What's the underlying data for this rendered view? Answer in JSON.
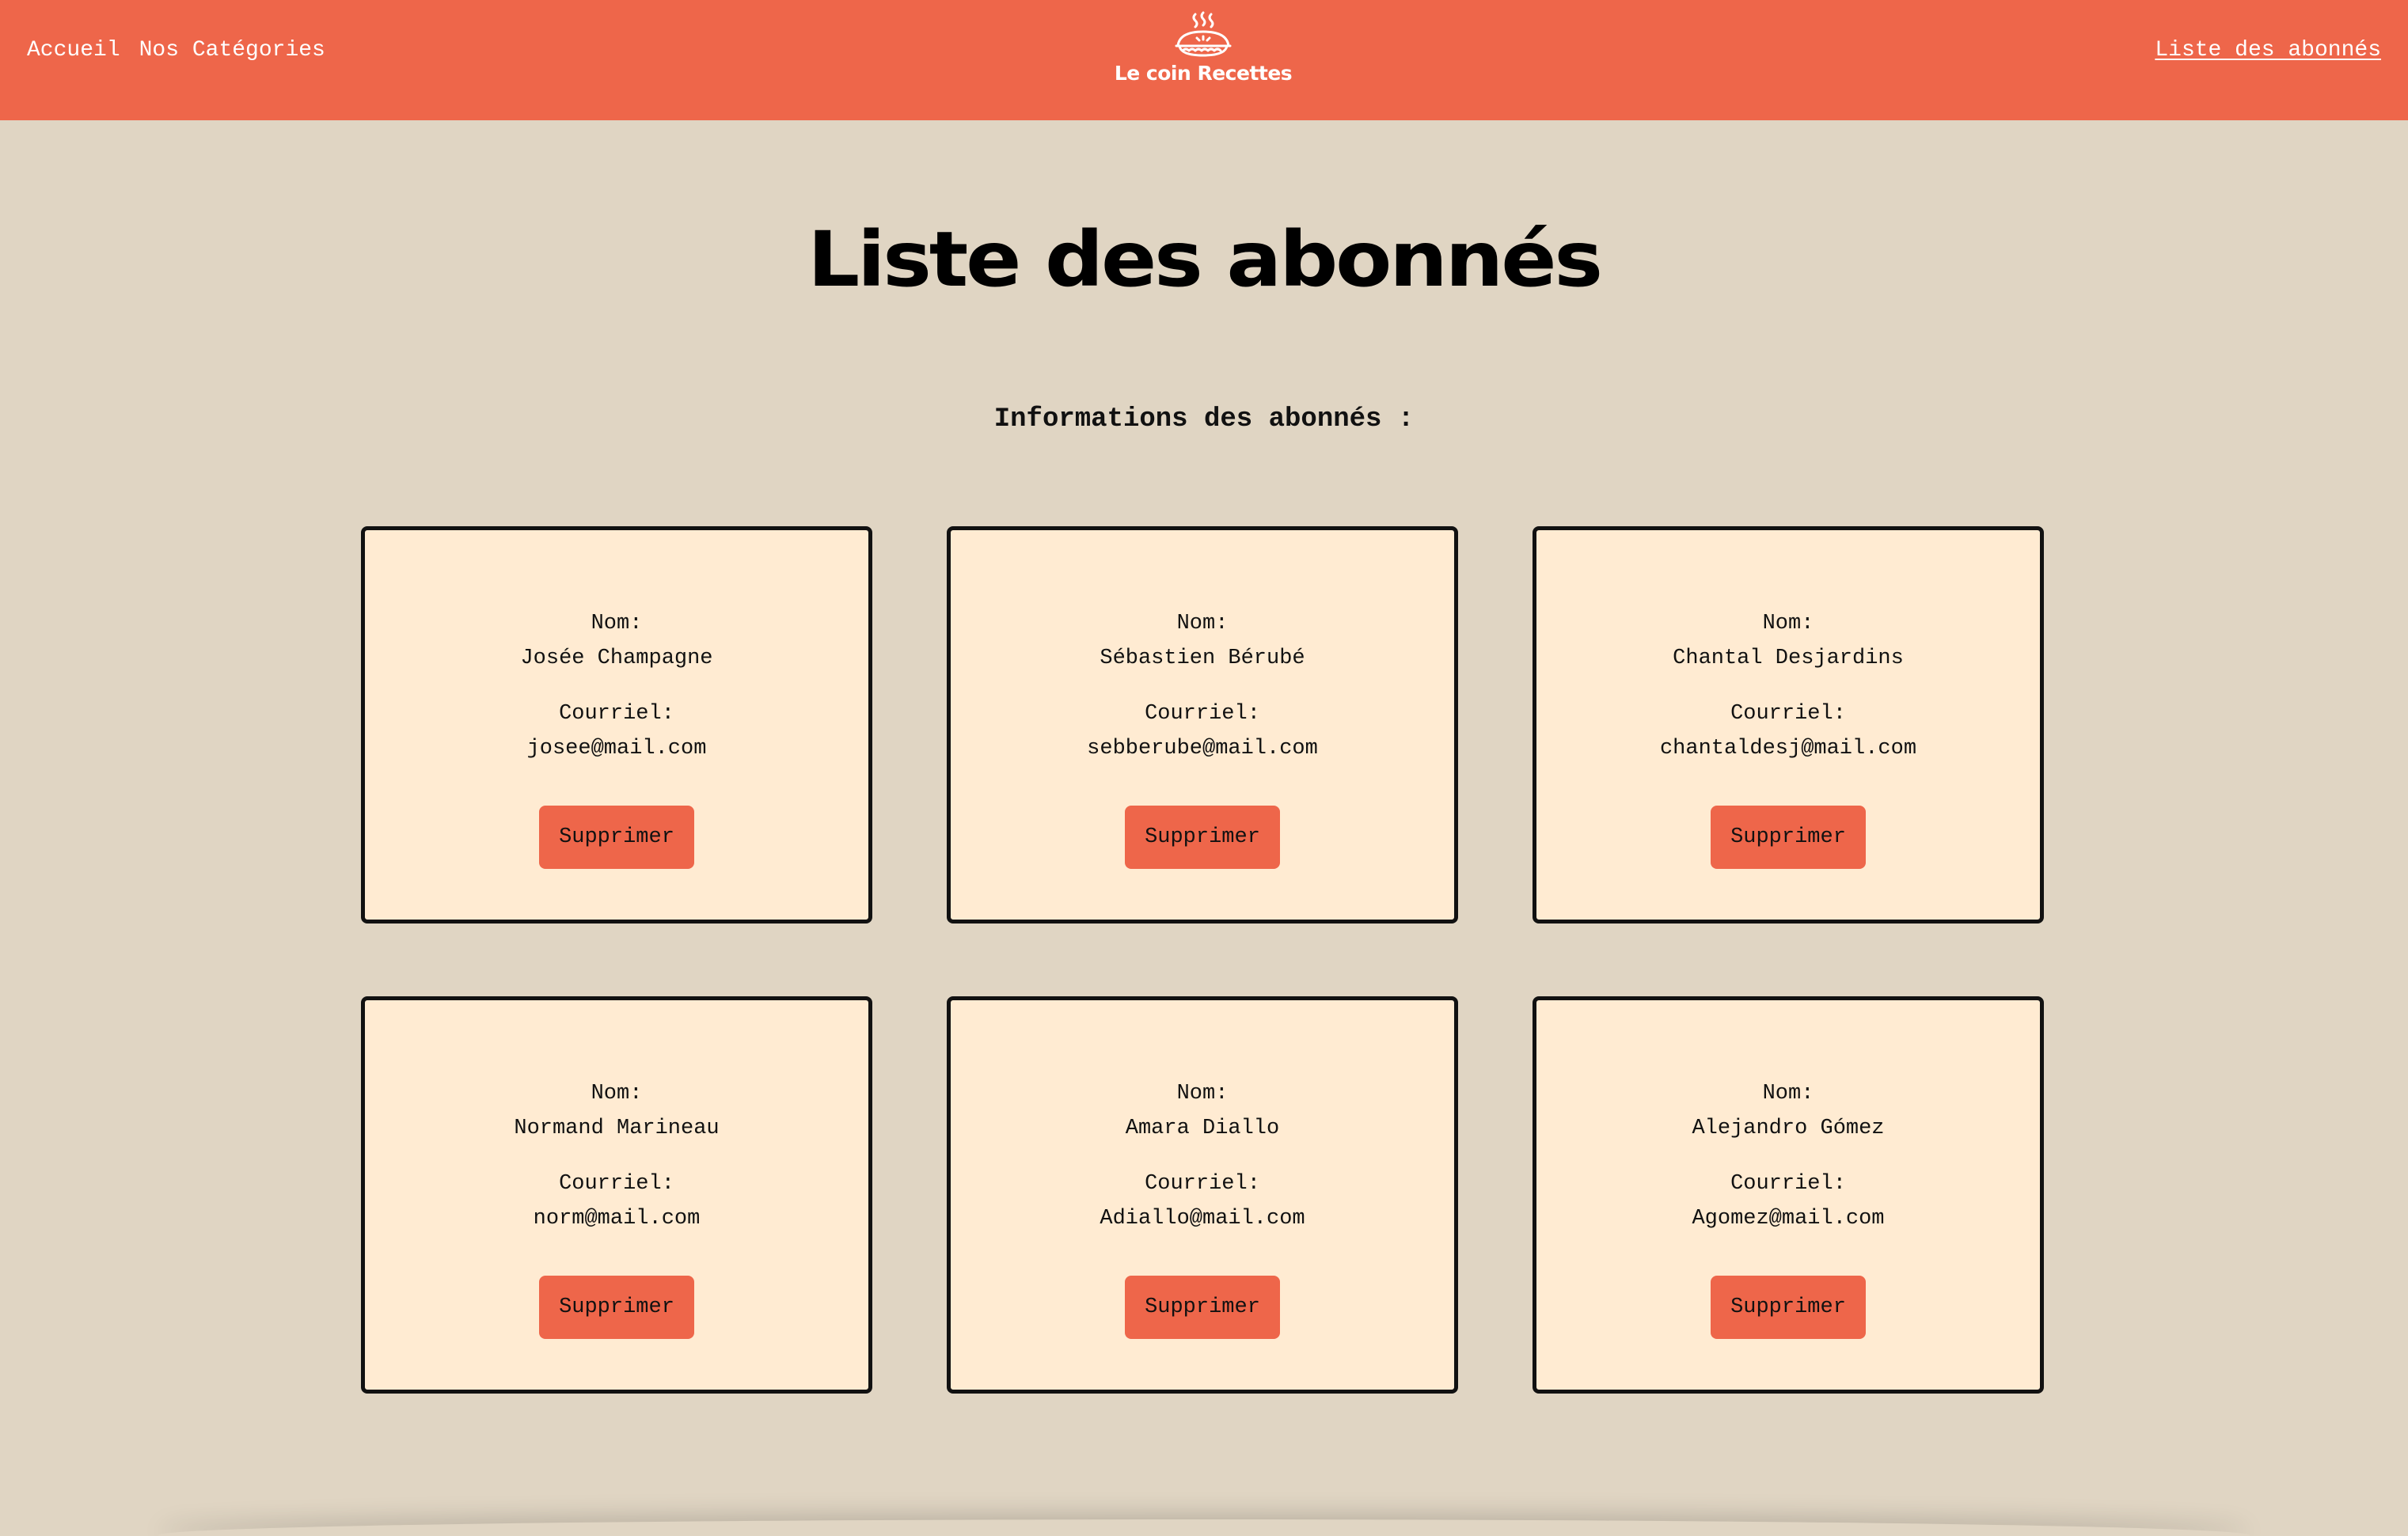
{
  "header": {
    "nav": [
      {
        "label": "Accueil"
      },
      {
        "label": "Nos Catégories"
      }
    ],
    "brand": "Le coin Recettes",
    "brand_icon": "pie-icon",
    "subscribers_link": "Liste des abonnés"
  },
  "main": {
    "title": "Liste des abonnés",
    "subtitle": "Informations des abonnés :",
    "subscribers": [
      {
        "name_label": "Nom:",
        "name": "Josée Champagne",
        "email_label": "Courriel:",
        "email": "josee@mail.com",
        "delete_label": "Supprimer"
      },
      {
        "name_label": "Nom:",
        "name": "Sébastien Bérubé",
        "email_label": "Courriel:",
        "email": "sebberube@mail.com",
        "delete_label": "Supprimer"
      },
      {
        "name_label": "Nom:",
        "name": "Chantal Desjardins",
        "email_label": "Courriel:",
        "email": "chantaldesj@mail.com",
        "delete_label": "Supprimer"
      },
      {
        "name_label": "Nom:",
        "name": "Normand Marineau",
        "email_label": "Courriel:",
        "email": "norm@mail.com",
        "delete_label": "Supprimer"
      },
      {
        "name_label": "Nom:",
        "name": "Amara Diallo",
        "email_label": "Courriel:",
        "email": "Adiallo@mail.com",
        "delete_label": "Supprimer"
      },
      {
        "name_label": "Nom:",
        "name": "Alejandro Gómez",
        "email_label": "Courriel:",
        "email": "Agomez@mail.com",
        "delete_label": "Supprimer"
      }
    ]
  },
  "colors": {
    "header": "#ee664a",
    "background": "#e0d5c3",
    "card": "#ffebd2",
    "button": "#ee664a",
    "border": "#111111"
  }
}
